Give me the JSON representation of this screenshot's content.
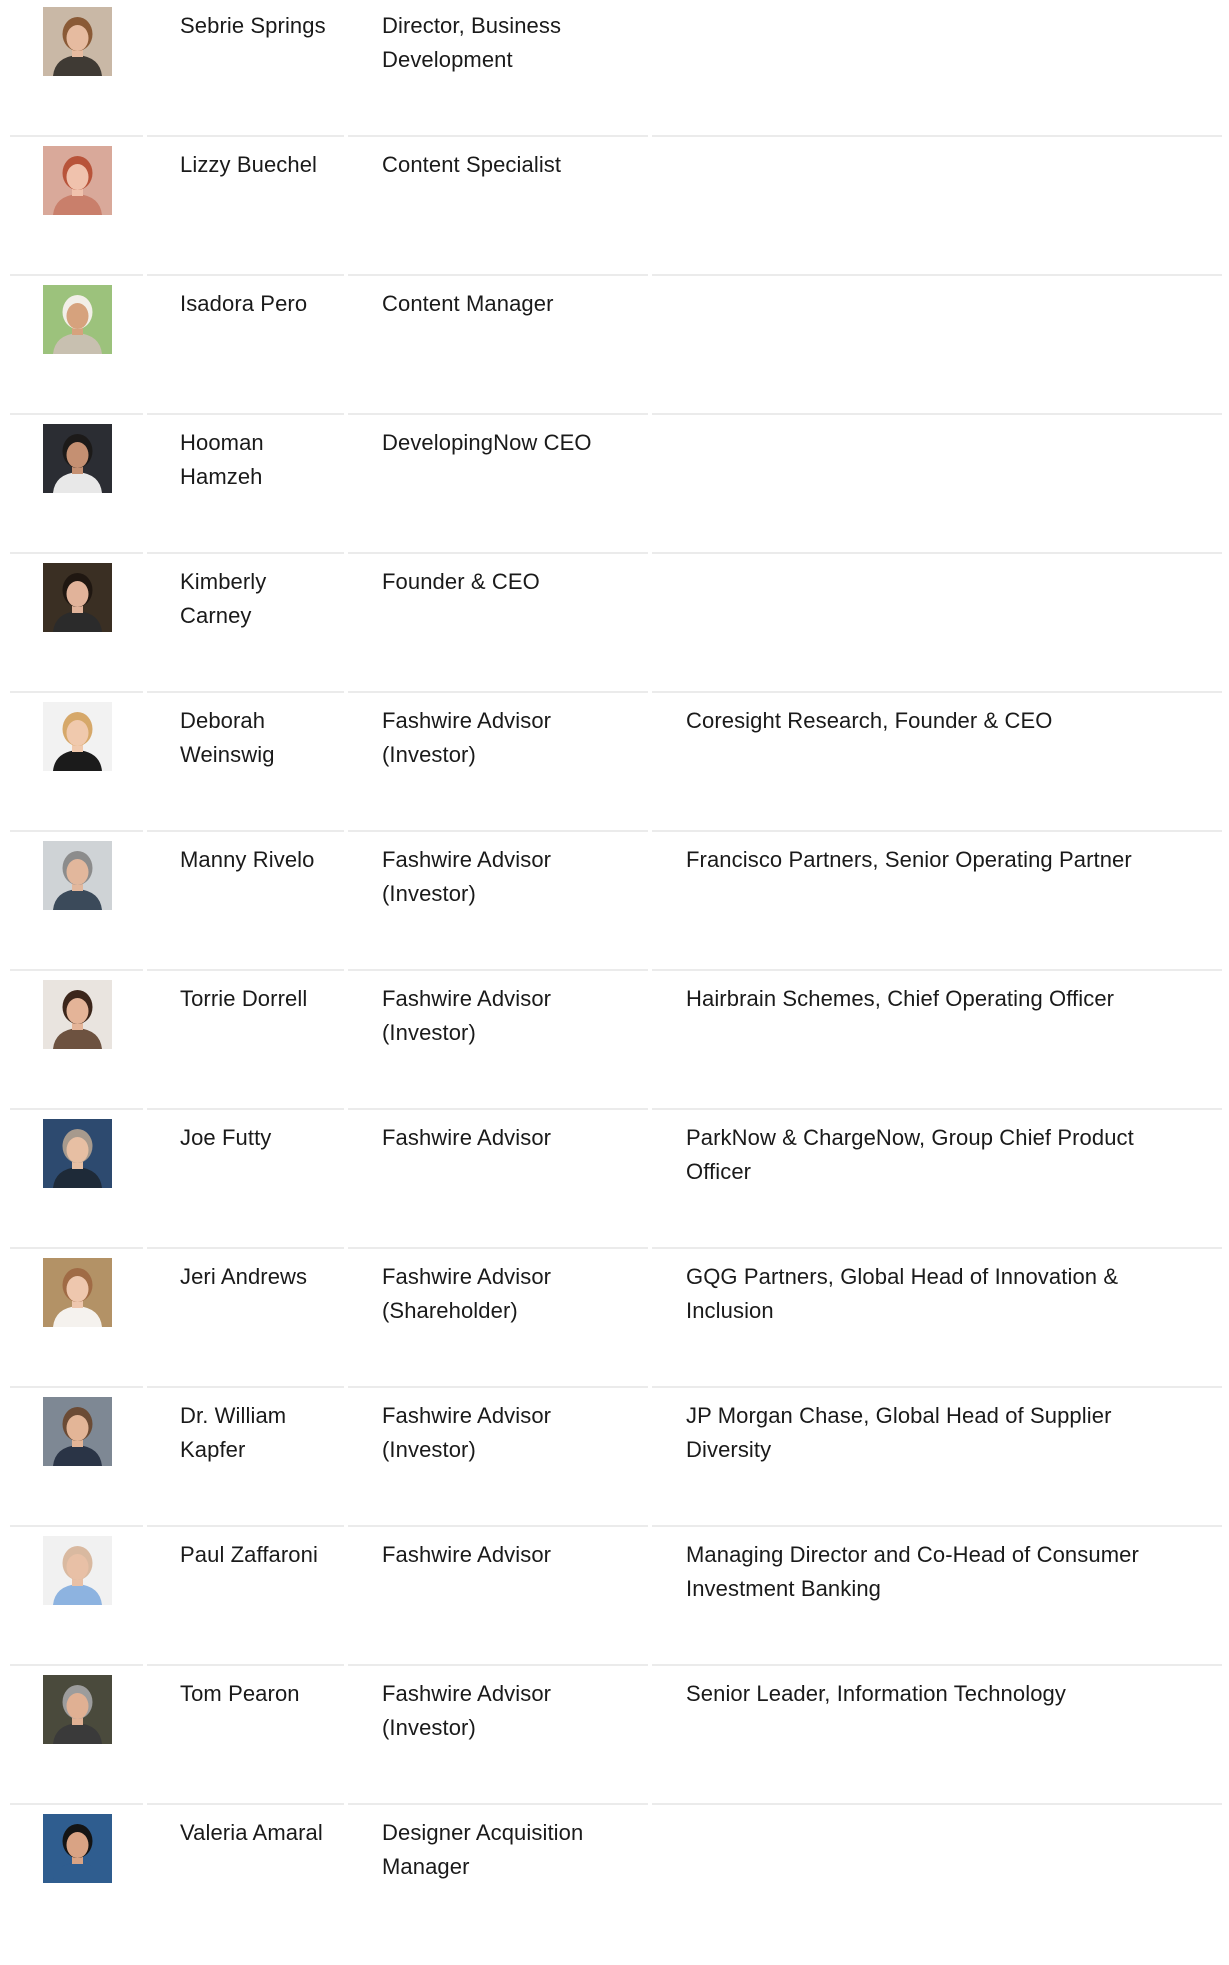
{
  "team": {
    "members": [
      {
        "name": "Sebrie Springs",
        "role": "Director, Business Development",
        "org": "",
        "photo": {
          "bg": "#c9b8a6",
          "skin": "#e6bba0",
          "hair": "#8a5a36",
          "shirt": "#3f3a34"
        }
      },
      {
        "name": "Lizzy Buechel",
        "role": "Content Specialist",
        "org": "",
        "photo": {
          "bg": "#d9a99a",
          "skin": "#f0c2ad",
          "hair": "#b8543a",
          "shirt": "#c97f6b"
        }
      },
      {
        "name": "Isadora Pero",
        "role": "Content Manager",
        "org": "",
        "photo": {
          "bg": "#9cc27c",
          "skin": "#d6a27d",
          "hair": "#f2efe8",
          "shirt": "#c8c0b0"
        }
      },
      {
        "name": "Hooman Hamzeh",
        "role": "DevelopingNow CEO",
        "org": "",
        "photo": {
          "bg": "#2b2d33",
          "skin": "#c59072",
          "hair": "#1c1a19",
          "shirt": "#e8e8e8"
        }
      },
      {
        "name": "Kimberly Carney",
        "role": "Founder & CEO",
        "org": "",
        "photo": {
          "bg": "#3a2f23",
          "skin": "#e1b39a",
          "hair": "#1f1711",
          "shirt": "#2b2b2b"
        }
      },
      {
        "name": "Deborah Weinswig",
        "role": "Fashwire Advisor (Investor)",
        "org": "Coresight Research, Founder & CEO",
        "photo": {
          "bg": "#f2f2f2",
          "skin": "#f0c9ad",
          "hair": "#d6a86a",
          "shirt": "#1b1b1b"
        }
      },
      {
        "name": "Manny Rivelo",
        "role": "Fashwire Advisor (Investor)",
        "org": "Francisco Partners, Senior Operating Partner",
        "photo": {
          "bg": "#cfd3d6",
          "skin": "#e2b79c",
          "hair": "#8c8c8c",
          "shirt": "#3b4a5a"
        }
      },
      {
        "name": "Torrie Dorrell",
        "role": "Fashwire Advisor (Investor)",
        "org": "Hairbrain Schemes, Chief Operating Officer",
        "photo": {
          "bg": "#e9e4df",
          "skin": "#e4b498",
          "hair": "#3c261b",
          "shirt": "#6d5240"
        }
      },
      {
        "name": "Joe Futty",
        "role": "Fashwire Advisor",
        "org": "ParkNow & ChargeNow, Group Chief Product Officer",
        "photo": {
          "bg": "#2d4a6f",
          "skin": "#e7bfa3",
          "hair": "#a79a8d",
          "shirt": "#1e2a38"
        }
      },
      {
        "name": "Jeri Andrews",
        "role": "Fashwire Advisor (Shareholder)",
        "org": "GQG Partners, Global Head of Innovation & Inclusion",
        "photo": {
          "bg": "#b39266",
          "skin": "#eec7ae",
          "hair": "#a06b45",
          "shirt": "#f5f2ee"
        }
      },
      {
        "name": "Dr. William Kapfer",
        "role": "Fashwire Advisor (Investor)",
        "org": "JP Morgan Chase, Global Head of Supplier Diversity",
        "photo": {
          "bg": "#7e8894",
          "skin": "#e3b597",
          "hair": "#6b4b35",
          "shirt": "#2a3446"
        }
      },
      {
        "name": "Paul Zaffaroni",
        "role": "Fashwire Advisor",
        "org": "Managing Director and Co-Head of Consumer Investment Banking",
        "photo": {
          "bg": "#f1f1f1",
          "skin": "#e8c0a6",
          "hair": "#d9b9a0",
          "shirt": "#8db3e0"
        }
      },
      {
        "name": "Tom Pearon",
        "role": "Fashwire Advisor (Investor)",
        "org": "Senior Leader, Information Technology",
        "photo": {
          "bg": "#4a4a3c",
          "skin": "#e0b093",
          "hair": "#9c9c9c",
          "shirt": "#3a3a3a"
        }
      },
      {
        "name": "Valeria Amaral",
        "role": "Designer Acquisition Manager",
        "org": "",
        "photo": {
          "bg": "#2f5d8f",
          "skin": "#d9a384",
          "hair": "#141414",
          "shirt": "#2f5d8f"
        }
      }
    ]
  }
}
